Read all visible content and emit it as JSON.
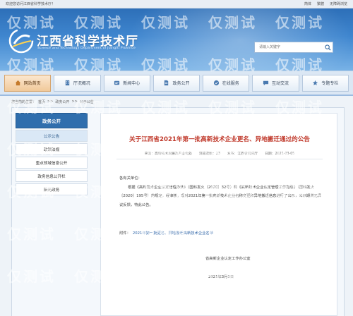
{
  "topbar": {
    "welcome": "欢迎您访问江西省科学技术厅！",
    "links": [
      "简体",
      "繁體",
      "无障碍浏览"
    ]
  },
  "header": {
    "title": "江西省科学技术厅",
    "subtitle": "Science and Technology Department of JiangXi Province",
    "search_placeholder": "请输入关键字"
  },
  "nav": {
    "items": [
      {
        "label": "网站首页",
        "icon": "home-icon",
        "active": true
      },
      {
        "label": "厅况概况",
        "icon": "building-icon",
        "active": false
      },
      {
        "label": "新闻中心",
        "icon": "news-icon",
        "active": false
      },
      {
        "label": "政务公开",
        "icon": "document-icon",
        "active": false
      },
      {
        "label": "在线服务",
        "icon": "service-icon",
        "active": false
      },
      {
        "label": "互动交流",
        "icon": "chat-icon",
        "active": false
      },
      {
        "label": "专题专栏",
        "icon": "topic-icon",
        "active": false
      }
    ]
  },
  "breadcrumb": {
    "prefix": "您当前的位置：",
    "items": [
      "首页",
      "政务公开",
      "公示公告"
    ],
    "separator": ">>"
  },
  "sidebar": {
    "heading": "政务公开",
    "items": [
      {
        "label": "公示公告",
        "active": true
      },
      {
        "label": "政策法规",
        "active": false
      },
      {
        "label": "重点领域信息公开",
        "active": false
      },
      {
        "label": "政务信息公开栏",
        "active": false
      },
      {
        "label": "阳光政务",
        "active": false
      }
    ]
  },
  "article": {
    "title": "关于江西省2021年第一批高新技术企业更名、异地搬迁通过的公告",
    "meta": {
      "source": "来源：高新技术发展及产业化处",
      "views": "浏览次数：23",
      "publisher": "发布：江西省科技厅",
      "date": "日期：2021-03-05"
    },
    "salutation": "各有关单位：",
    "body": "根据《高新技术企业认定管理办法》（国科发火〔2020〕32号）和《高新技术企业认定管理工作指引》（国科发火〔2020〕195号）的规定，经审核，现对2021年第一批高新技术企业名称变更和异地搬迁信息进行了公示，公示期满无异议反馈，特此公告。",
    "attachment_label": "附件：",
    "attachment_link": "2021年第一批更名、异地搬迁高新技术企业名单",
    "signature": "省高新企业认定工作办公室",
    "sign_date": "2021年3月3日"
  },
  "colors": {
    "title_red": "#c0392b",
    "banner_blue": "#2d6fb8",
    "sidebar_head": "#2f6ead"
  }
}
